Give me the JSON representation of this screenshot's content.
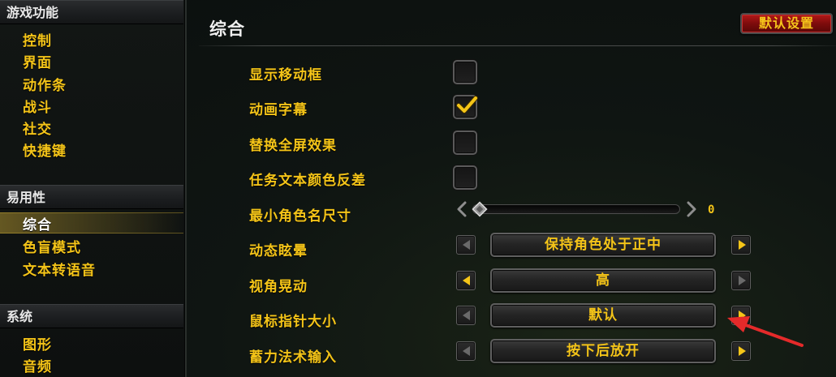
{
  "sidebar": {
    "categories": [
      {
        "title": "游戏功能",
        "items": [
          "控制",
          "界面",
          "动作条",
          "战斗",
          "社交",
          "快捷键"
        ]
      },
      {
        "title": "易用性",
        "items": [
          "综合",
          "色盲模式",
          "文本转语音"
        ]
      },
      {
        "title": "系统",
        "items": [
          "图形",
          "音频"
        ]
      }
    ],
    "active_item": "综合"
  },
  "main": {
    "title": "综合",
    "default_button": "默认设置",
    "options": [
      {
        "label": "显示移动框",
        "type": "checkbox",
        "checked": false
      },
      {
        "label": "动画字幕",
        "type": "checkbox",
        "checked": true
      },
      {
        "label": "替换全屏效果",
        "type": "checkbox",
        "checked": false
      },
      {
        "label": "任务文本颜色反差",
        "type": "checkbox",
        "checked": false
      },
      {
        "label": "最小角色名尺寸",
        "type": "slider",
        "value": "0"
      },
      {
        "label": "动态眩晕",
        "type": "selector",
        "value": "保持角色处于正中",
        "left_enabled": false,
        "right_enabled": true
      },
      {
        "label": "视角晃动",
        "type": "selector",
        "value": "高",
        "left_enabled": true,
        "right_enabled": false
      },
      {
        "label": "鼠标指针大小",
        "type": "selector",
        "value": "默认",
        "left_enabled": false,
        "right_enabled": true
      },
      {
        "label": "蓄力法术输入",
        "type": "selector",
        "value": "按下后放开",
        "left_enabled": false,
        "right_enabled": true
      }
    ]
  },
  "colors": {
    "label_gold": "#f4c418",
    "button_red": "#8e1010",
    "annotation_red": "#e52a2a"
  },
  "icons": {
    "check": "checkmark-icon",
    "arrow_left": "triangle-left-icon",
    "arrow_right": "triangle-right-icon",
    "annotation": "red-pointer-arrow"
  }
}
